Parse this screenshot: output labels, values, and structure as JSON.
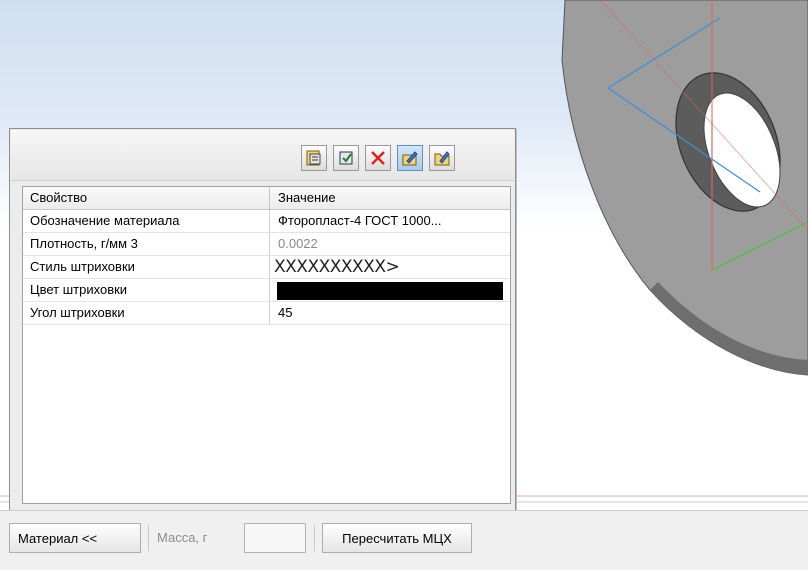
{
  "panel": {
    "toolbar_icons": [
      "material-library-icon",
      "material-apply-icon",
      "delete-icon",
      "edit-properties-icon",
      "open-folder-icon"
    ],
    "table": {
      "headers": [
        "Свойство",
        "Значение"
      ],
      "rows": [
        {
          "property": "Обозначение материала",
          "value": "Фторопласт-4  ГОСТ 1000..."
        },
        {
          "property": "Плотность, г/мм 3",
          "value": "0.0022"
        },
        {
          "property": "Стиль штриховки",
          "value": "XXXXXXXXXX>"
        },
        {
          "property": "Цвет штриховки",
          "value": "",
          "swatch_color": "#000000"
        },
        {
          "property": "Угол штриховки",
          "value": "45"
        }
      ]
    }
  },
  "statusbar": {
    "material_label": "Материал  <<",
    "mass_label": "Масса, г",
    "mass_value": "",
    "recalc_label": "Пересчитать МЦХ"
  },
  "colors": {
    "viewport_top": "#cfdff2",
    "part_gray": "#9d9d9d",
    "axis_blue": "#3d8fd6",
    "axis_green": "#49c23c",
    "axis_red": "#e06060"
  }
}
